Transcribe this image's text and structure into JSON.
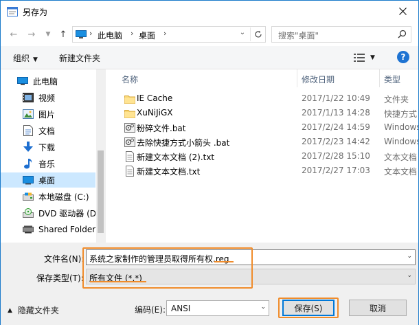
{
  "window": {
    "title": "另存为"
  },
  "nav": {
    "breadcrumbs": [
      "此电脑",
      "桌面"
    ],
    "search_placeholder": "搜索\"桌面\""
  },
  "toolbar": {
    "organize": "组织",
    "new_folder": "新建文件夹"
  },
  "sidebar": {
    "items": [
      {
        "label": "此电脑",
        "icon": "pc-icon"
      },
      {
        "label": "视频",
        "icon": "video-icon"
      },
      {
        "label": "图片",
        "icon": "picture-icon"
      },
      {
        "label": "文档",
        "icon": "document-icon"
      },
      {
        "label": "下载",
        "icon": "download-icon"
      },
      {
        "label": "音乐",
        "icon": "music-icon"
      },
      {
        "label": "桌面",
        "icon": "desktop-icon",
        "selected": true
      },
      {
        "label": "本地磁盘 (C:)",
        "icon": "disk-icon"
      },
      {
        "label": "DVD 驱动器 (D:",
        "icon": "dvd-icon"
      },
      {
        "label": "Shared Folders",
        "icon": "shared-icon"
      }
    ]
  },
  "columns": {
    "name": "名称",
    "date": "修改日期",
    "type": "类型"
  },
  "files": [
    {
      "name": "IE Cache",
      "date": "2017/1/22 10:49",
      "type": "文件夹",
      "icon": "folder-icon"
    },
    {
      "name": "XuNiJiGX",
      "date": "2017/1/13 14:28",
      "type": "快捷方式",
      "icon": "folder-icon"
    },
    {
      "name": "粉碎文件.bat",
      "date": "2017/2/24 14:59",
      "type": "Windows",
      "icon": "bat-icon"
    },
    {
      "name": "去除快捷方式小箭头 .bat",
      "date": "2017/2/23 14:42",
      "type": "Windows",
      "icon": "bat-icon"
    },
    {
      "name": "新建文本文档 (2).txt",
      "date": "2017/2/28 15:10",
      "type": "文本文档",
      "icon": "txt-icon"
    },
    {
      "name": "新建文本文档.txt",
      "date": "2017/2/27 17:03",
      "type": "文本文档",
      "icon": "txt-icon"
    }
  ],
  "form": {
    "filename_label": "文件名(N):",
    "filename_value": "系统之家制作的管理员取得所有权.reg",
    "filetype_label": "保存类型(T):",
    "filetype_value": "所有文件  (*.*)",
    "hide_folders": "隐藏文件夹",
    "encoding_label": "编码(E):",
    "encoding_value": "ANSI",
    "save": "保存(S)",
    "cancel": "取消"
  },
  "colors": {
    "highlight": "#f08c2b",
    "accent": "#0078d7",
    "selected": "#cce8ff"
  }
}
